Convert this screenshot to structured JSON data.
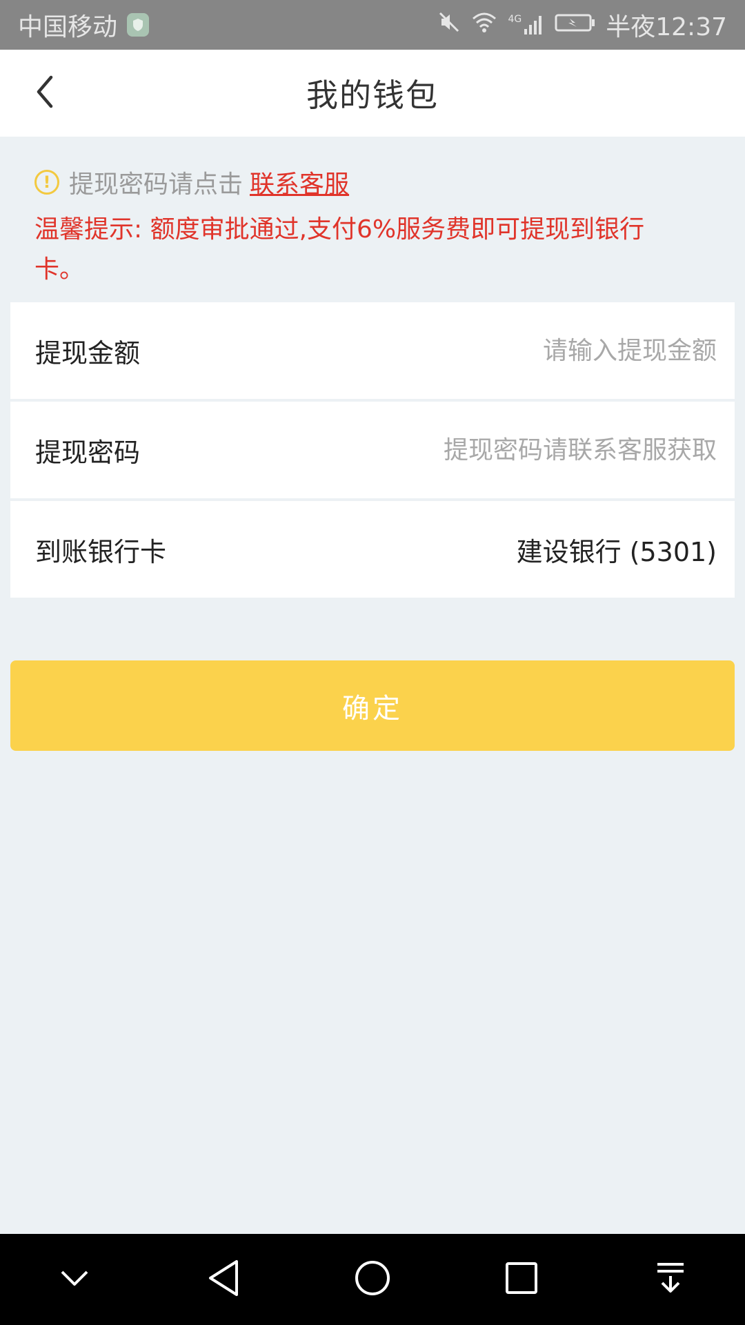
{
  "statusbar": {
    "carrier": "中国移动",
    "network": "4G",
    "time_prefix": "半夜",
    "time": "12:37"
  },
  "header": {
    "title": "我的钱包"
  },
  "notice": {
    "hint": "提现密码请点击",
    "link": "联系客服",
    "warning": "温馨提示: 额度审批通过,支付6%服务费即可提现到银行卡。"
  },
  "form": {
    "amount_label": "提现金额",
    "amount_placeholder": "请输入提现金额",
    "password_label": "提现密码",
    "password_placeholder": "提现密码请联系客服获取",
    "card_label": "到账银行卡",
    "card_value": "建设银行 (5301)"
  },
  "confirm_label": "确定",
  "colors": {
    "accent_yellow": "#fbd24c",
    "warning_red": "#e0342a",
    "background": "#ecf1f4"
  },
  "icons": [
    "shield-icon",
    "mute-icon",
    "wifi-icon",
    "signal-icon",
    "battery-icon",
    "back-icon",
    "warning-icon",
    "nav-collapse-icon",
    "nav-back-icon",
    "nav-home-icon",
    "nav-recent-icon",
    "nav-notification-icon"
  ]
}
